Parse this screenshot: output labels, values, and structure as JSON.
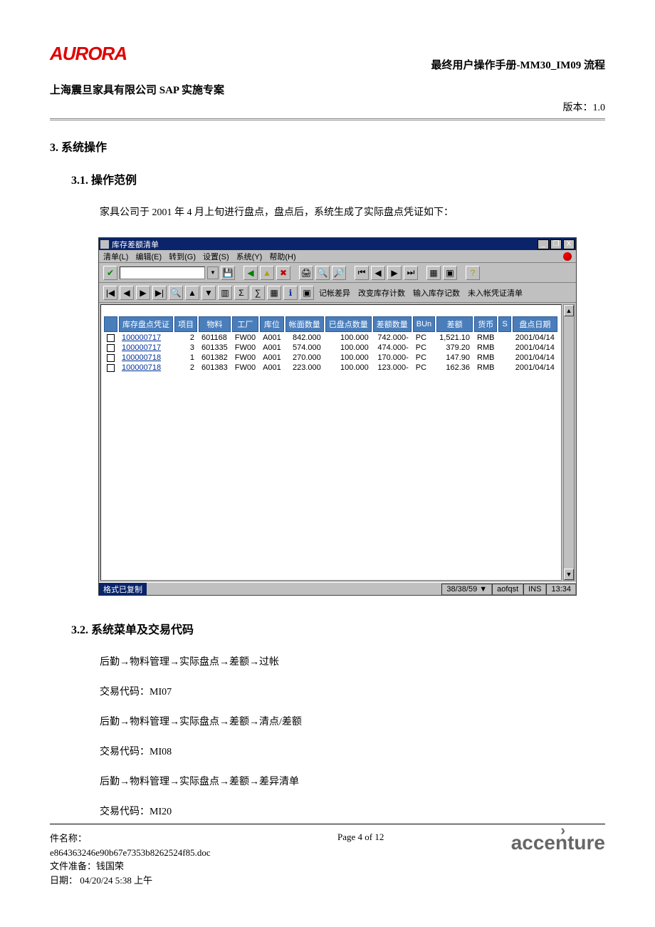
{
  "header": {
    "logo_text": "AURORA",
    "doc_title_right": "最终用户操作手册-MM30_IM09 流程",
    "company_line": "上海震旦家具有限公司 SAP 实施专案",
    "version_label": "版本：1.0"
  },
  "section3_title": "3.  系统操作",
  "section31_title": "3.1.      操作范例",
  "intro_para": "家具公司于 2001 年 4 月上旬进行盘点，盘点后，系统生成了实际盘点凭证如下：",
  "sap": {
    "window_title": "库存差额清单",
    "win_btn_min": "_",
    "win_btn_max": "❐",
    "win_btn_close": "X",
    "menu_items": [
      "清单(L)",
      "编辑(E)",
      "转到(G)",
      "设置(S)",
      "系统(Y)",
      "帮助(H)"
    ],
    "toolbar2_labels": [
      "记帐差异",
      "改变库存计数",
      "输入库存记数",
      "未入帐凭证清单"
    ],
    "columns": [
      "库存盘点凭证",
      "项目",
      "物料",
      "工厂",
      "库位",
      "帐面数量",
      "已盘点数量",
      "差额数量",
      "BUn",
      "差额",
      "货币",
      "S",
      "盘点日期"
    ],
    "rows": [
      {
        "chk": "",
        "pz": "100000717",
        "xm": "2",
        "wl": "601168",
        "gc": "FW00",
        "kw": "A001",
        "zm": "842.000",
        "yp": "100.000",
        "ce": "742.000-",
        "bun": "PC",
        "de": "1,521.10",
        "hb": "RMB",
        "s": "",
        "rq": "2001/04/14"
      },
      {
        "chk": "",
        "pz": "100000717",
        "xm": "3",
        "wl": "601335",
        "gc": "FW00",
        "kw": "A001",
        "zm": "574.000",
        "yp": "100.000",
        "ce": "474.000-",
        "bun": "PC",
        "de": "379.20",
        "hb": "RMB",
        "s": "",
        "rq": "2001/04/14"
      },
      {
        "chk": "",
        "pz": "100000718",
        "xm": "1",
        "wl": "601382",
        "gc": "FW00",
        "kw": "A001",
        "zm": "270.000",
        "yp": "100.000",
        "ce": "170.000-",
        "bun": "PC",
        "de": "147.90",
        "hb": "RMB",
        "s": "",
        "rq": "2001/04/14"
      },
      {
        "chk": "",
        "pz": "100000718",
        "xm": "2",
        "wl": "601383",
        "gc": "FW00",
        "kw": "A001",
        "zm": "223.000",
        "yp": "100.000",
        "ce": "123.000-",
        "bun": "PC",
        "de": "162.36",
        "hb": "RMB",
        "s": "",
        "rq": "2001/04/14"
      }
    ],
    "status_left": "格式已复制",
    "status_right": [
      "38/38/59 ▼",
      "aofqst",
      "INS",
      "13:34"
    ]
  },
  "section32_title": "3.2.      系统菜单及交易代码",
  "menu_paths": [
    "后勤→物料管理→实际盘点→差额→过帐",
    "交易代码：MI07",
    "后勤→物料管理→实际盘点→差额→清点/差额",
    "交易代码：MI08",
    "后勤→物料管理→实际盘点→差额→差异清单",
    "交易代码：MI20"
  ],
  "footer": {
    "file_label": "件名称：",
    "file_name": "e864363246e90b67e7353b8262524f85.doc",
    "prep_label": "文件准备：钱国荣",
    "date_label": "日期：    04/20/24 5:38 上午",
    "page_info": "Page 4 of 12",
    "vendor_logo": "accenture"
  }
}
